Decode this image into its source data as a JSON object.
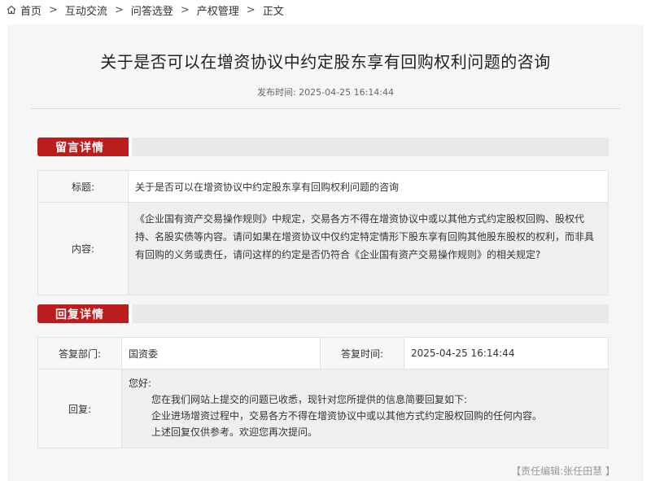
{
  "breadcrumb": {
    "items": [
      "首页",
      "互动交流",
      "问答选登",
      "产权管理",
      "正文"
    ],
    "separator": ">"
  },
  "article": {
    "title": "关于是否可以在增资协议中约定股东享有回购权利问题的咨询",
    "publish_time": "发布时间:  2025-04-25 16:14:44"
  },
  "question_section": {
    "header": "留言详情",
    "title_label": "标题:",
    "title_value": "关于是否可以在增资协议中约定股东享有回购权利问题的咨询",
    "content_label": "内容:",
    "content_value": "《企业国有资产交易操作规则》中规定，交易各方不得在增资协议中或以其他方式约定股权回购、股权代持、名股实债等内容。请问如果在增资协议中仅约定特定情形下股东享有回购其他股东股权的权利，而非具有回购的义务或责任，请问这样的约定是否仍符合《企业国有资产交易操作规则》的相关规定?"
  },
  "reply_section": {
    "header": "回复详情",
    "dept_label": "答复部门:",
    "dept_value": "国资委",
    "time_label": "答复时间:",
    "time_value": "2025-04-25 16:14:44",
    "reply_label": "回复:",
    "reply_greeting": "您好:",
    "reply_line1": "您在我们网站上提交的问题已收悉，现针对您所提供的信息简要回复如下:",
    "reply_line2": "企业进场增资过程中，交易各方不得在增资协议中或以其他方式约定股权回购的任何内容。",
    "reply_line3": "上述回复仅供参考。欢迎您再次提问。"
  },
  "editor": "【责任编辑:张任田慧 】",
  "colors": {
    "accent": "#bb1d1d",
    "card_bg": "#f6f6f6"
  },
  "icons": {
    "home": "home-icon"
  }
}
